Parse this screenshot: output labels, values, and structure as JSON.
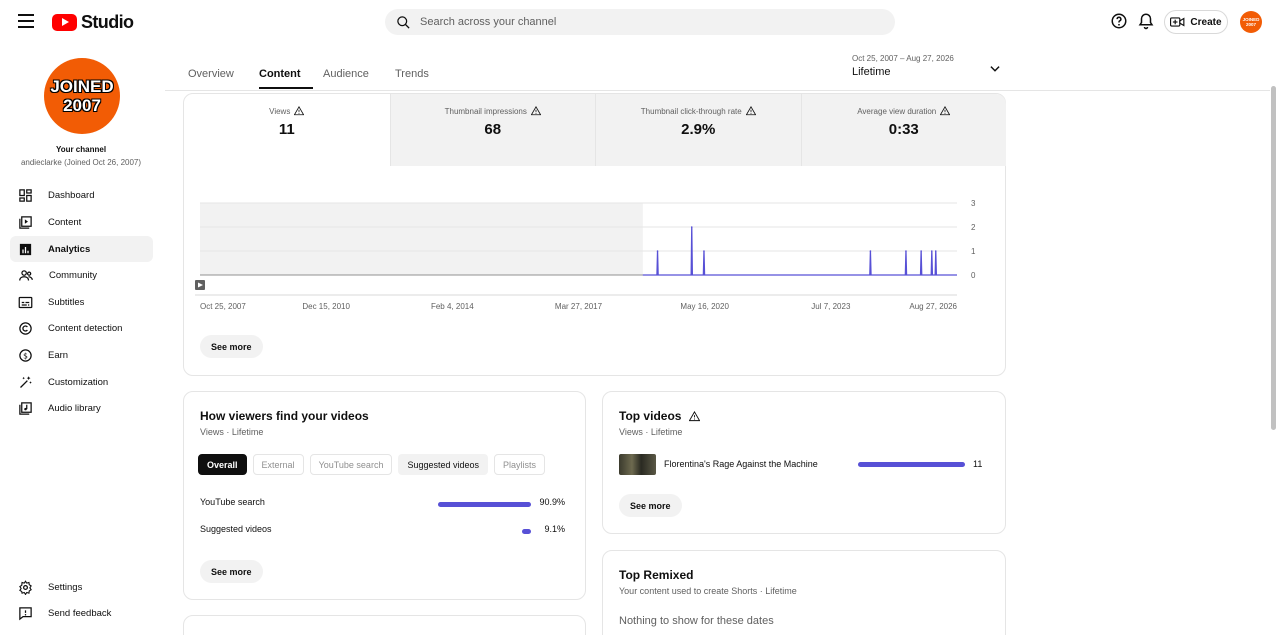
{
  "header": {
    "logo_text": "Studio",
    "search_placeholder": "Search across your channel",
    "create_label": "Create",
    "avatar_text": "JOINED 2007"
  },
  "sidebar": {
    "avatar_text_line1": "JOINED",
    "avatar_text_line2": "2007",
    "your_channel": "Your channel",
    "handle": "andieclarke (Joined Oct 26, 2007)",
    "items": [
      {
        "label": "Dashboard",
        "icon": "dashboard-icon"
      },
      {
        "label": "Content",
        "icon": "content-icon"
      },
      {
        "label": "Analytics",
        "icon": "analytics-icon"
      },
      {
        "label": "Community",
        "icon": "community-icon"
      },
      {
        "label": "Subtitles",
        "icon": "subtitles-icon"
      },
      {
        "label": "Content detection",
        "icon": "copyright-icon"
      },
      {
        "label": "Earn",
        "icon": "earn-icon"
      },
      {
        "label": "Customization",
        "icon": "customization-icon"
      },
      {
        "label": "Audio library",
        "icon": "audio-library-icon"
      }
    ],
    "bottom_items": [
      {
        "label": "Settings",
        "icon": "settings-icon"
      },
      {
        "label": "Send feedback",
        "icon": "feedback-icon"
      }
    ]
  },
  "tabs": [
    {
      "label": "Overview",
      "active": false
    },
    {
      "label": "Content",
      "active": true
    },
    {
      "label": "Audience",
      "active": false
    },
    {
      "label": "Trends",
      "active": false
    }
  ],
  "date_picker": {
    "range": "Oct 25, 2007 – Aug 27, 2026",
    "label": "Lifetime"
  },
  "metrics": [
    {
      "label": "Views",
      "value": "11"
    },
    {
      "label": "Thumbnail impressions",
      "value": "68"
    },
    {
      "label": "Thumbnail click-through rate",
      "value": "2.9%"
    },
    {
      "label": "Average view duration",
      "value": "0:33"
    }
  ],
  "chart_data": {
    "type": "line",
    "x_ticks": [
      "Oct 25, 2007",
      "Dec 15, 2010",
      "Feb 4, 2014",
      "Mar 27, 2017",
      "May 16, 2020",
      "Jul 7, 2023",
      "Aug 27, 2026"
    ],
    "y_ticks": [
      "0",
      "1",
      "2",
      "3"
    ],
    "ylim": [
      0,
      3
    ],
    "xlim": [
      "2007-10-25",
      "2026-08-27"
    ],
    "shaded_until": "2018-11-01",
    "color": "#5750d6",
    "series": [
      {
        "points": [
          {
            "x": "2019-03-15",
            "y": 1
          },
          {
            "x": "2020-01-20",
            "y": 2
          },
          {
            "x": "2020-05-10",
            "y": 1
          },
          {
            "x": "2024-07-01",
            "y": 1
          },
          {
            "x": "2025-05-20",
            "y": 1
          },
          {
            "x": "2025-10-05",
            "y": 1
          },
          {
            "x": "2026-01-10",
            "y": 1
          },
          {
            "x": "2026-02-15",
            "y": 1
          }
        ]
      }
    ]
  },
  "overview_card": {
    "see_more": "See more"
  },
  "traffic": {
    "title": "How viewers find your videos",
    "subtitle": "Views · Lifetime",
    "chips": [
      {
        "label": "Overall",
        "state": "selected"
      },
      {
        "label": "External",
        "state": "disabled"
      },
      {
        "label": "YouTube search",
        "state": "disabled"
      },
      {
        "label": "Suggested videos",
        "state": "enabled"
      },
      {
        "label": "Playlists",
        "state": "disabled"
      }
    ],
    "rows": [
      {
        "label": "YouTube search",
        "pct": "90.9%",
        "fraction": 0.909
      },
      {
        "label": "Suggested videos",
        "pct": "9.1%",
        "fraction": 0.091
      }
    ],
    "see_more": "See more"
  },
  "top_videos": {
    "title": "Top videos",
    "subtitle": "Views · Lifetime",
    "rows": [
      {
        "title": "Florentina's Rage Against the Machine",
        "views": "11"
      }
    ],
    "see_more": "See more"
  },
  "top_remixed": {
    "title": "Top Remixed",
    "subtitle": "Your content used to create Shorts · Lifetime",
    "empty": "Nothing to show for these dates"
  }
}
